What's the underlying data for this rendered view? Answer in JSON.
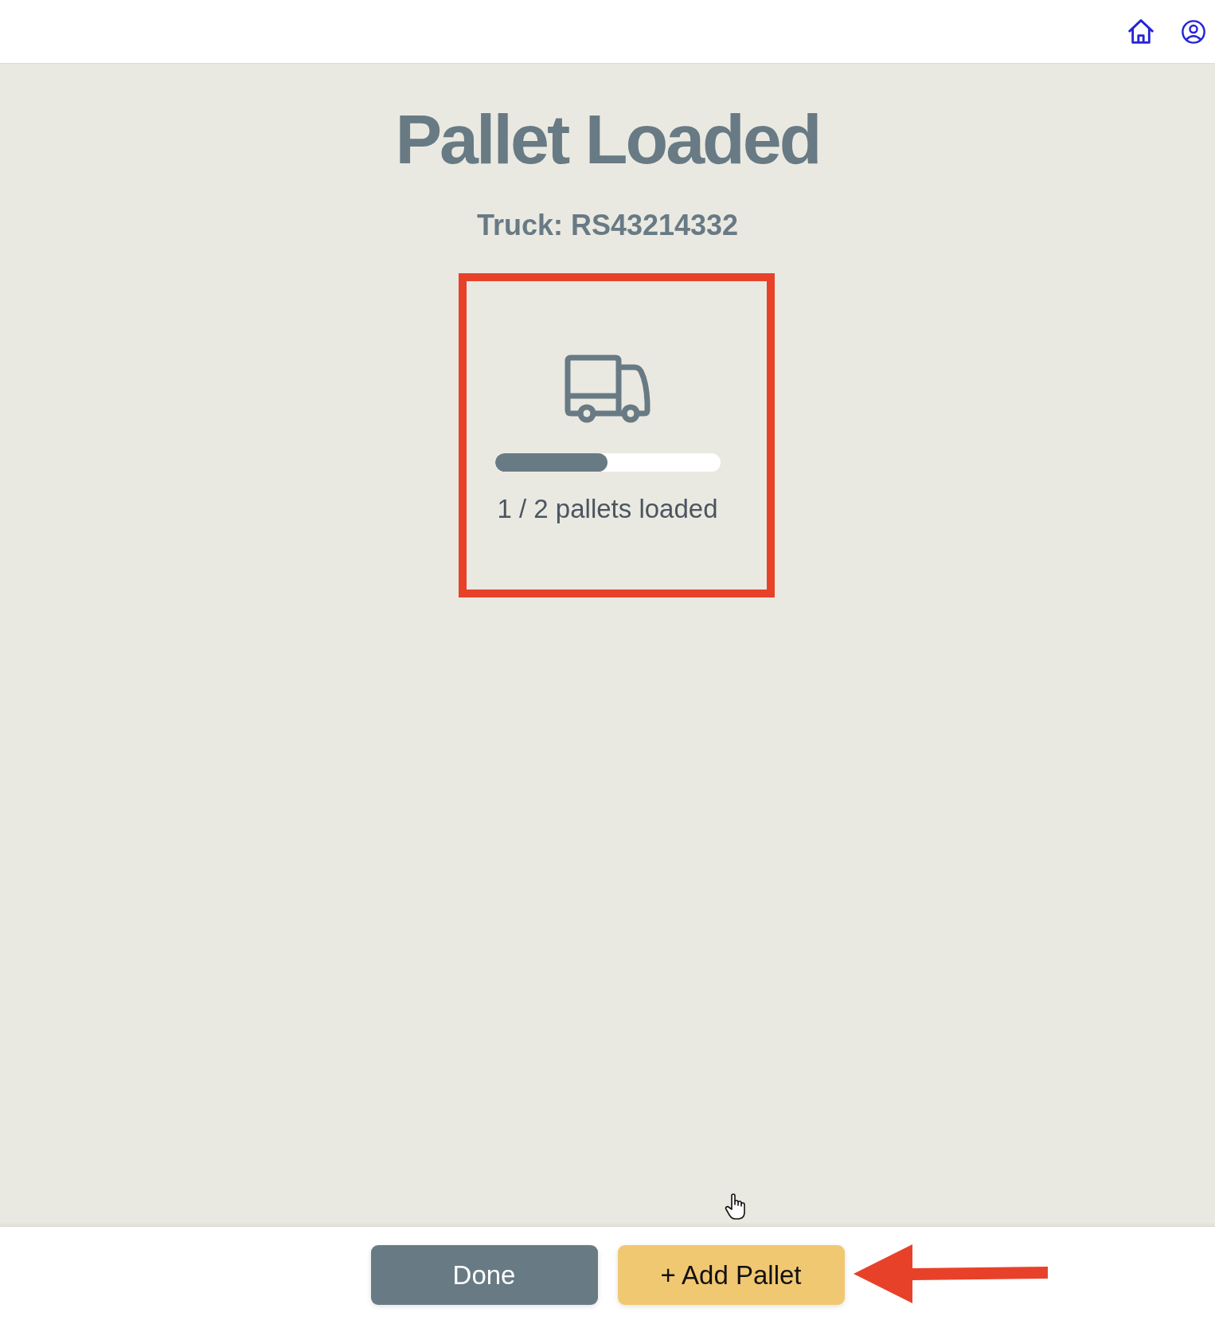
{
  "title": "Pallet Loaded",
  "subtitle": "Truck: RS43214332",
  "progress": {
    "highlighted": true,
    "level": 0.5,
    "caption": "1 / 2 pallets loaded"
  },
  "cursor": {
    "kind": "hand"
  },
  "buttons": [
    {
      "label": "Done",
      "kind": "secondary",
      "annotated": false
    },
    {
      "label": "+ Add Pallet",
      "kind": "primary",
      "annotated": true
    }
  ]
}
